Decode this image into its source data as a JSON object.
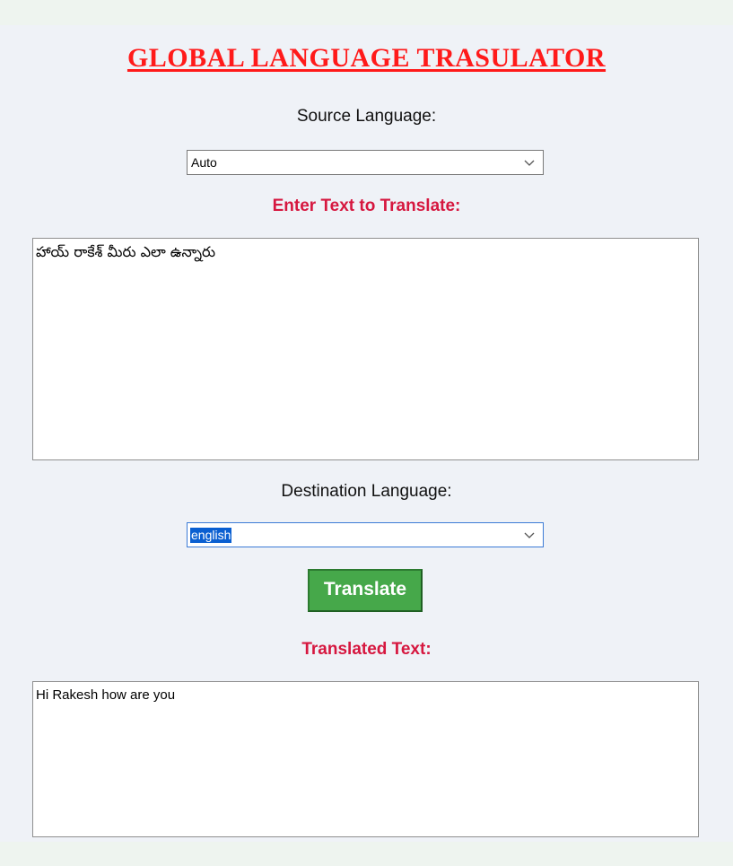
{
  "app": {
    "title": "GLOBAL LANGUAGE TRASULATOR"
  },
  "source": {
    "label": "Source Language:",
    "selected": "Auto"
  },
  "input": {
    "label": "Enter Text to Translate:",
    "value": "హాయ్ రాకేశ్ మీరు ఎలా ఉన్నారు"
  },
  "destination": {
    "label": "Destination Language:",
    "selected": "english"
  },
  "actions": {
    "translate_label": "Translate"
  },
  "output": {
    "label": "Translated Text:",
    "value": "Hi Rakesh how are you"
  },
  "colors": {
    "title": "#ff1a1a",
    "accent_label": "#d6173f",
    "button": "#46a84a",
    "background": "#eff2f7"
  },
  "icons": {
    "dropdown": "chevron-down-icon"
  }
}
